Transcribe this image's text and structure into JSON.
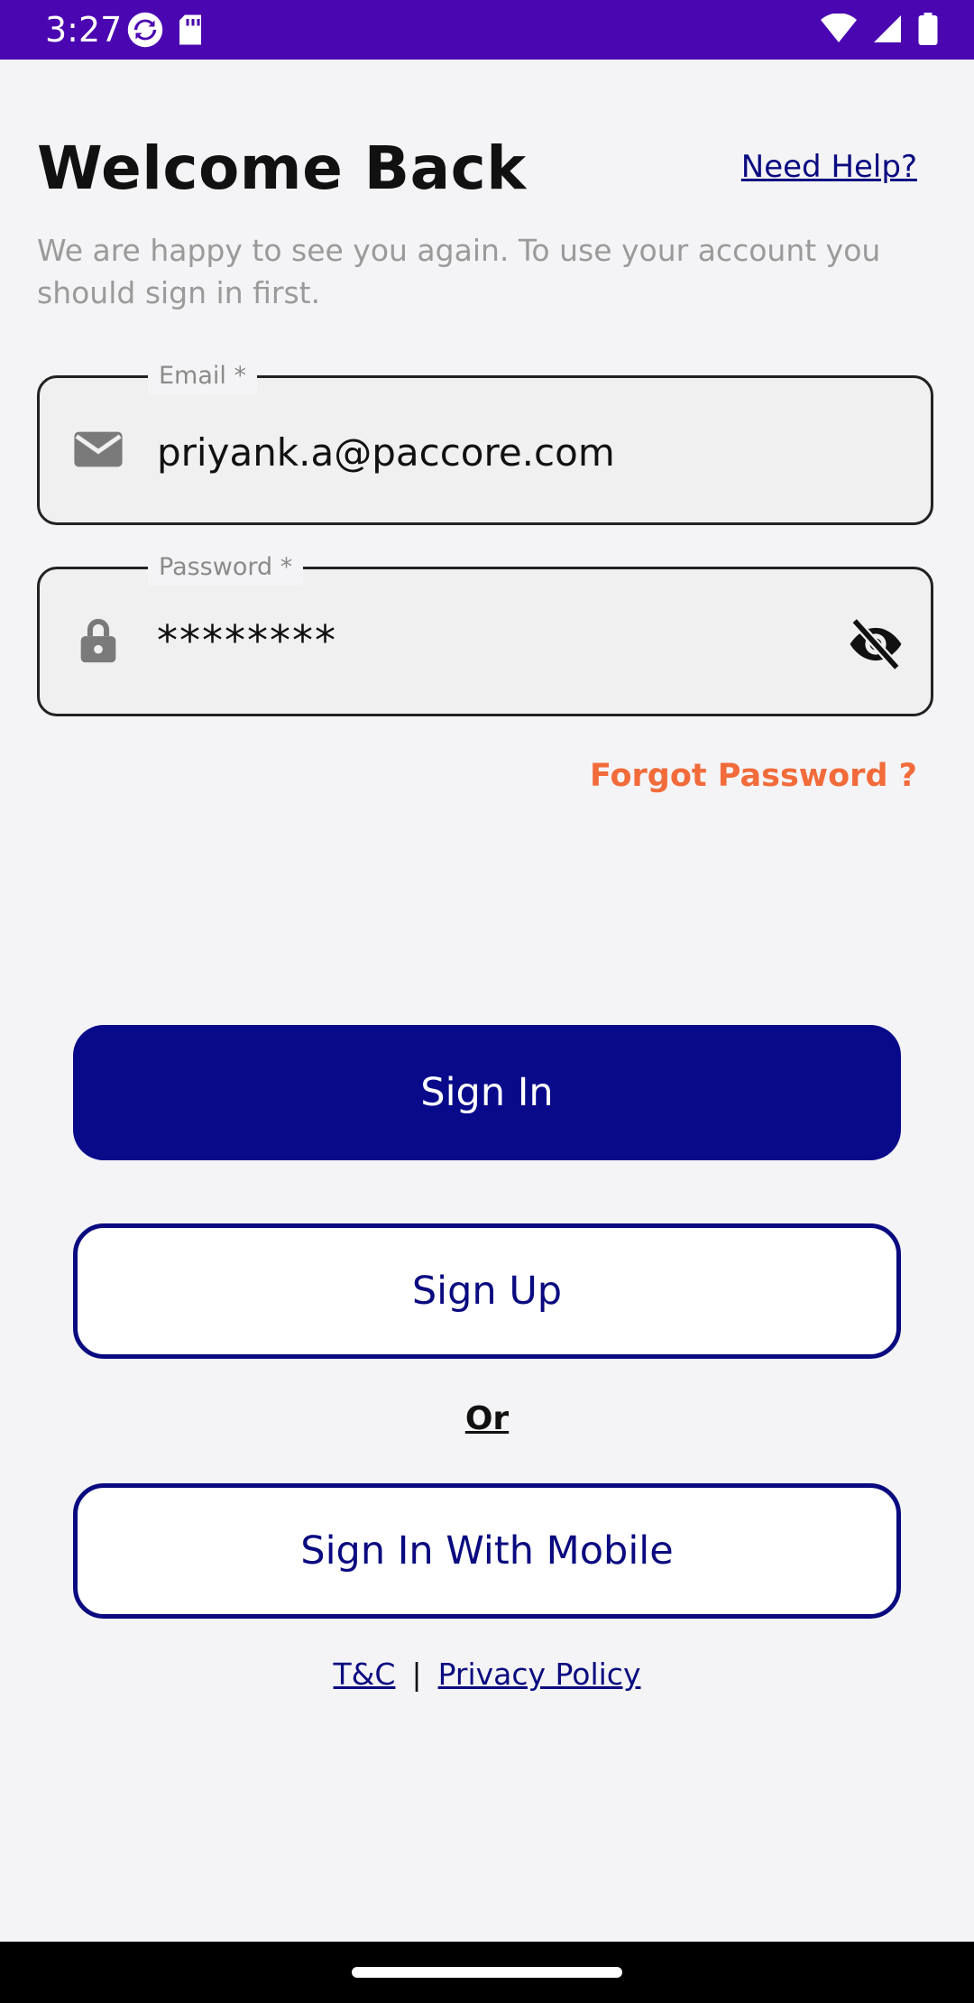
{
  "status_bar": {
    "time": "3:27",
    "icons_left": [
      "sync-icon",
      "sd-card-icon"
    ],
    "icons_right": [
      "wifi-icon",
      "signal-icon",
      "battery-icon"
    ]
  },
  "header": {
    "title": "Welcome Back",
    "help_link": "Need Help?",
    "subtitle": "We are happy to see you again. To use your account you should sign in first."
  },
  "form": {
    "email": {
      "label": "Email *",
      "value": "priyank.a@paccore.com",
      "icon": "mail-icon"
    },
    "password": {
      "label": "Password *",
      "value": "********",
      "icon": "lock-icon",
      "toggle_icon": "eye-off-icon"
    },
    "forgot_password": "Forgot Password ?"
  },
  "actions": {
    "sign_in": "Sign In",
    "sign_up": "Sign Up",
    "or": "Or",
    "sign_in_mobile": "Sign In With Mobile"
  },
  "footer": {
    "terms": "T&C",
    "separator": "|",
    "privacy": "Privacy Policy"
  },
  "colors": {
    "status_bar": "#4a06b0",
    "primary": "#080a8a",
    "accent": "#f26b3a",
    "background": "#f4f4f6"
  }
}
